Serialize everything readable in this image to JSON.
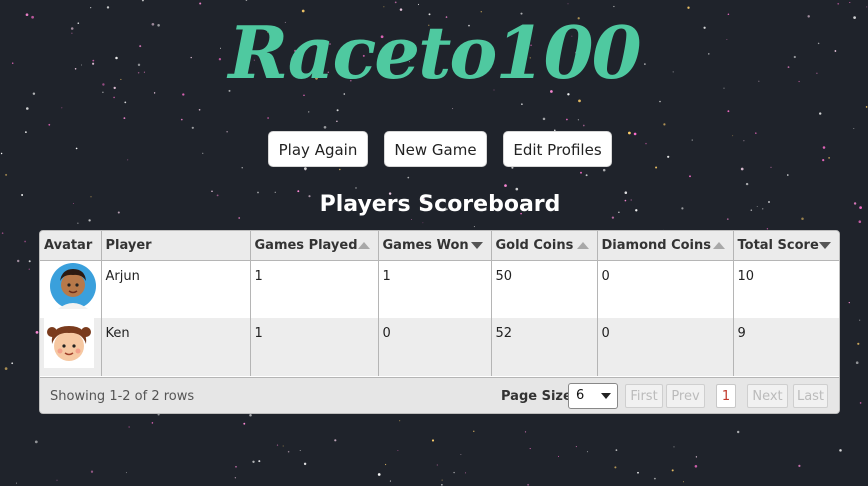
{
  "app": {
    "title": "Raceto100"
  },
  "actions": {
    "play_again": "Play Again",
    "new_game": "New Game",
    "edit_profiles": "Edit Profiles"
  },
  "scoreboard": {
    "title": "Players Scoreboard",
    "columns": [
      "Avatar",
      "Player",
      "Games Played",
      "Games Won",
      "Gold Coins",
      "Diamond Coins",
      "Total Score"
    ],
    "rows": [
      {
        "avatar": "boy-avatar",
        "player": "Arjun",
        "games_played": "1",
        "games_won": "1",
        "gold_coins": "50",
        "diamond_coins": "0",
        "total_score": "10"
      },
      {
        "avatar": "girl-avatar",
        "player": "Ken",
        "games_played": "1",
        "games_won": "0",
        "gold_coins": "52",
        "diamond_coins": "0",
        "total_score": "9"
      }
    ],
    "sorted_by": "Total Score",
    "sort_direction": "descending"
  },
  "pagination": {
    "showing": "Showing 1-2 of 2 rows",
    "page_size_label": "Page Size",
    "page_size": "6",
    "page_size_options": [
      "6"
    ],
    "first": "First",
    "prev": "Prev",
    "page": "1",
    "next": "Next",
    "last": "Last"
  },
  "colors": {
    "background": "#1f232b",
    "title": "#4fc9a0",
    "active_page": "#c0392b"
  }
}
